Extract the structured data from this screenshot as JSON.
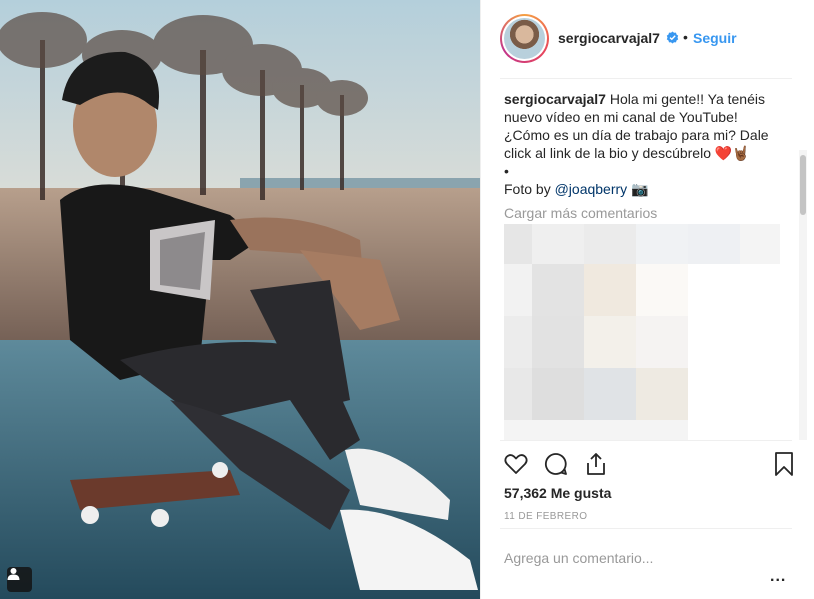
{
  "post": {
    "username": "sergiocarvajal7",
    "separator_dot": "•",
    "follow_label": "Seguir",
    "caption": {
      "username": "sergiocarvajal7",
      "text": "Hola mi gente!! Ya tenéis nuevo vídeo en mi canal de YouTube! ¿Cómo es un día de trabajo para mi? Dale click al link de la bio y descúbrelo",
      "emoji": "❤️🤘🏾",
      "bullet": "•",
      "credit_prefix": "Foto by ",
      "credit_mention": "@joaqberry",
      "credit_emoji": "📷"
    },
    "load_more_label": "Cargar más comentarios",
    "likes_text": "57,362 Me gusta",
    "date_text": "11 DE FEBRERO",
    "comment_placeholder": "Agrega un comentario...",
    "more_label": "..."
  },
  "icons": {
    "heart": "heart-icon",
    "comment": "comment-icon",
    "share": "share-icon",
    "bookmark": "bookmark-icon",
    "verified": "verified-badge-icon",
    "tag": "tagged-user-icon"
  },
  "colors": {
    "link_blue": "#3897f0",
    "verified_blue": "#3897f0",
    "text": "#262626",
    "muted": "#999999",
    "border": "#efefef"
  }
}
